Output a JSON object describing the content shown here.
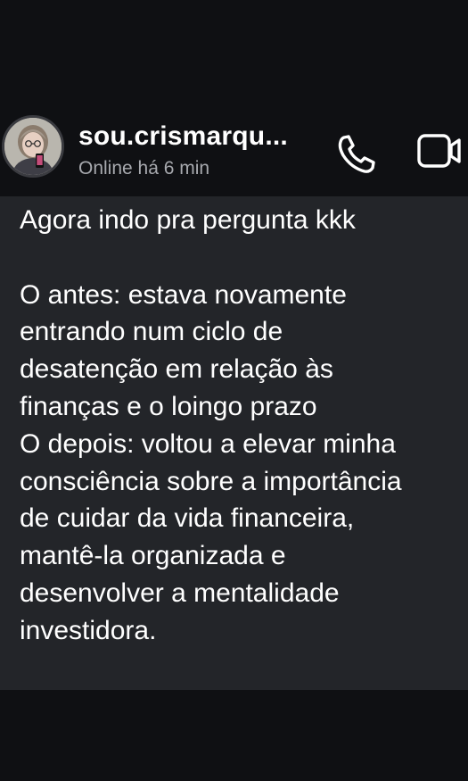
{
  "contact": {
    "name": "sou.crismarqu...",
    "status": "Online há 6 min"
  },
  "actions": {
    "call_icon": "phone-icon",
    "video_icon": "video-camera-icon"
  },
  "message": {
    "lines": [
      "Agora indo pra pergunta kkk",
      "",
      "O antes: estava novamente",
      "entrando num ciclo de",
      "desatenção em relação às",
      "finanças e o loingo prazo",
      "O depois: voltou a elevar minha",
      "consciência sobre a importância",
      "de cuidar da vida financeira,",
      "mantê-la organizada e",
      "desenvolver a mentalidade",
      "investidora."
    ]
  },
  "colors": {
    "background": "#0f1013",
    "bubble": "#232529",
    "text": "#ffffff",
    "status_text": "#a7a9ae"
  }
}
